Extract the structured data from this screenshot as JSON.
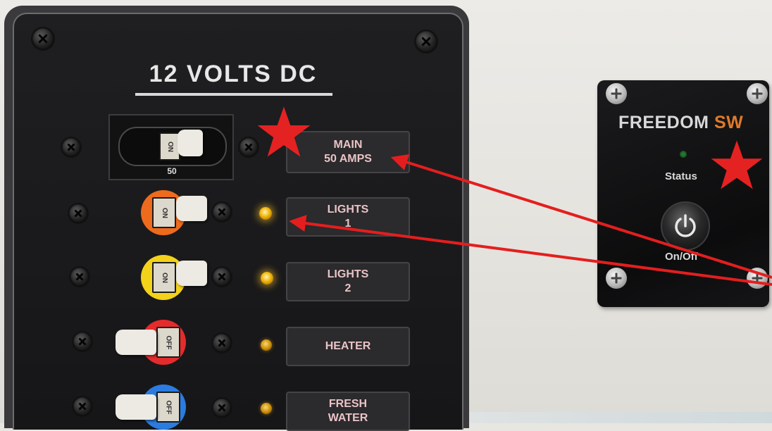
{
  "panel": {
    "title": "12 VOLTS DC",
    "main_breaker_rating": "50",
    "labels": [
      {
        "line1": "MAIN",
        "line2": "50  AMPS"
      },
      {
        "line1": "LIGHTS",
        "line2": "1"
      },
      {
        "line1": "LIGHTS",
        "line2": "2"
      },
      {
        "line1": "HEATER",
        "line2": ""
      },
      {
        "line1": "FRESH",
        "line2": "WATER"
      }
    ],
    "breaker_states": [
      "ON",
      "ON",
      "ON",
      "OFF",
      "OFF"
    ],
    "ring_colors": [
      "#ee6a1c",
      "#f3d21a",
      "#e52b2b",
      "#2b7ce0"
    ]
  },
  "freedom_switch": {
    "brand_part1": "FREEDOM ",
    "brand_part2": "SW",
    "status_label": "Status",
    "button_label": "On/Off"
  },
  "annotations": {
    "star_color": "#e52222",
    "arrow_color": "#e41e1e"
  }
}
